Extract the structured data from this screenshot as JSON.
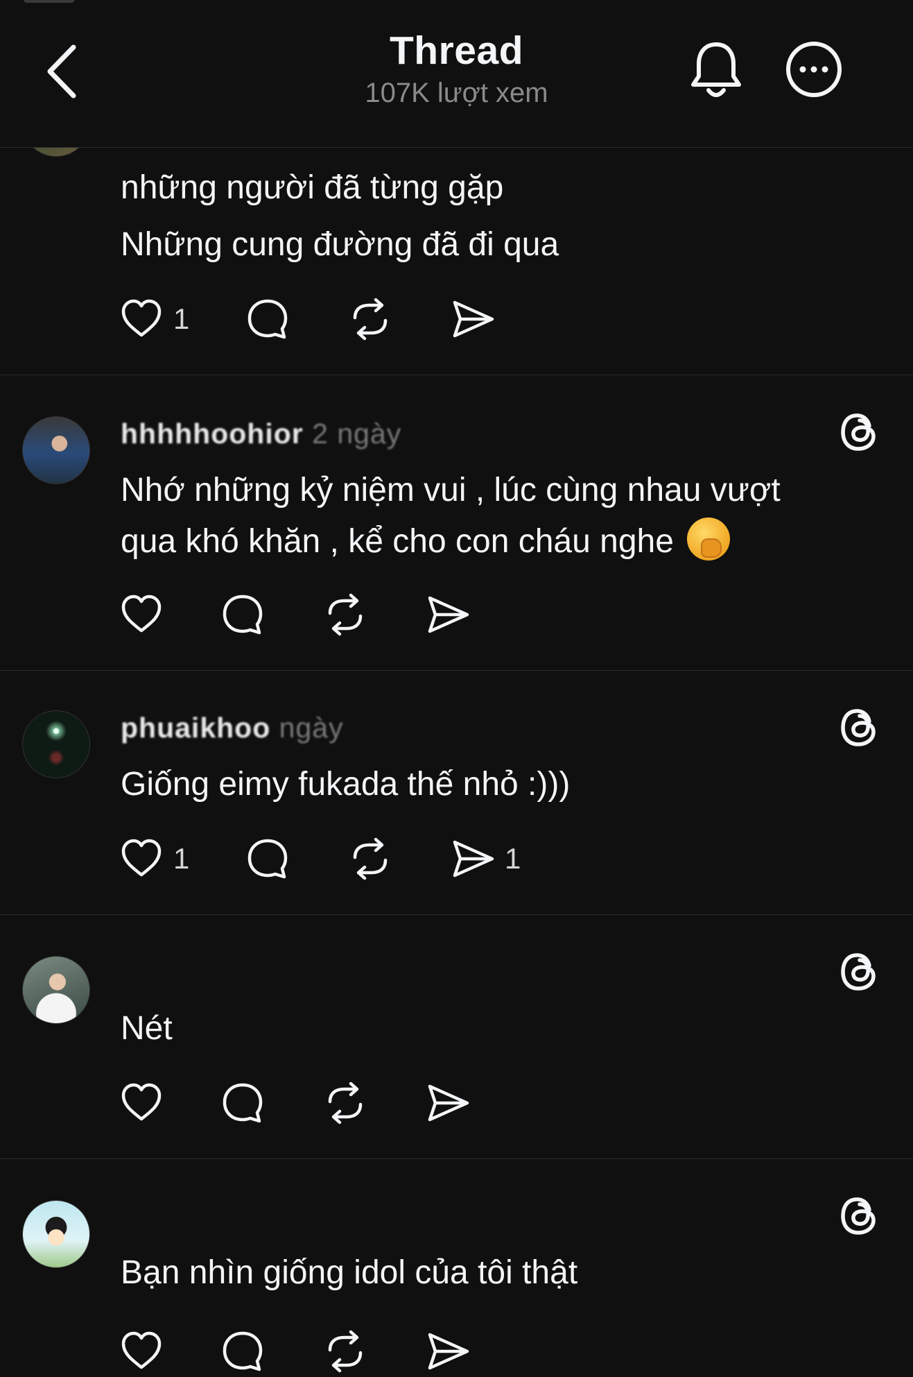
{
  "header": {
    "title": "Thread",
    "views": "107K lượt xem",
    "back_icon": "chevron-left-icon",
    "bell_icon": "bell-icon",
    "more_icon": "more-circle-icon"
  },
  "posts": [
    {
      "username": "",
      "time": "",
      "lines": [
        "những người đã từng gặp",
        "Những cung đường đã đi qua"
      ],
      "likes": "1",
      "shares": ""
    },
    {
      "username": "hhhhhoohior",
      "time": "2 ngày",
      "lines": [
        "Nhớ những kỷ niệm vui , lúc cùng nhau vượt",
        "qua khó khăn , kể cho con cháu nghe"
      ],
      "emoji": "🤭",
      "likes": "",
      "shares": ""
    },
    {
      "username": "phuaikhoo",
      "time": "ngày",
      "lines": [
        "Giống eimy fukada thế nhỏ :)))"
      ],
      "likes": "1",
      "shares": "1"
    },
    {
      "username": "",
      "time": "",
      "lines": [
        "Nét"
      ],
      "likes": "",
      "shares": ""
    },
    {
      "username": "",
      "time": "",
      "lines": [
        "Bạn nhìn giống idol của tôi thật"
      ],
      "likes": "",
      "shares": ""
    }
  ],
  "colors": {
    "background": "#101010",
    "text": "#f3f5f7",
    "muted": "#8a8a8a",
    "divider": "#2c2c2c"
  }
}
